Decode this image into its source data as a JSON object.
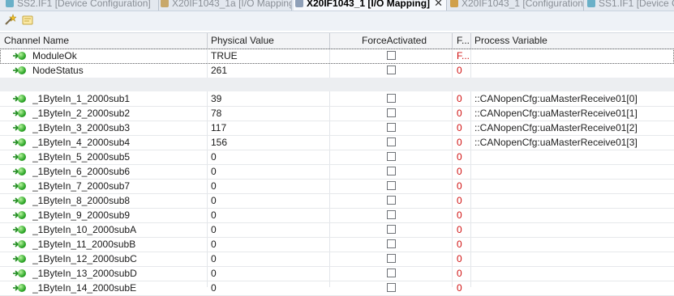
{
  "tabs": [
    {
      "label": "SS2.IF1 [Device Configuration]",
      "active": false,
      "icon_color": "#6ab0c8"
    },
    {
      "label": "X20IF1043_1a [I/O Mapping]",
      "active": false,
      "icon_color": "#c8a86a"
    },
    {
      "label": "X20IF1043_1 [I/O Mapping]",
      "active": true,
      "icon_color": "#8fa0b8"
    },
    {
      "label": "X20IF1043_1 [Configuration]",
      "active": false,
      "icon_color": "#d0a04a"
    },
    {
      "label": "SS1.IF1 [Device C",
      "active": false,
      "icon_color": "#6ab0c8"
    }
  ],
  "close_glyph": "✕",
  "toolbar": {
    "icons": [
      "wand-icon",
      "note-icon"
    ]
  },
  "columns": {
    "channel_name": "Channel Name",
    "physical_value": "Physical Value",
    "force_activated": "ForceActivated",
    "force_value": "F...",
    "process_variable": "Process Variable"
  },
  "rows": [
    {
      "name": "ModuleOk",
      "value": "TRUE",
      "force_activated": false,
      "force_value": "F...",
      "process_variable": "",
      "selected": true
    },
    {
      "name": "NodeStatus",
      "value": "261",
      "force_activated": false,
      "force_value": "0",
      "process_variable": ""
    },
    {
      "gap": true
    },
    {
      "name": "_1ByteIn_1_2000sub1",
      "value": "39",
      "force_activated": false,
      "force_value": "0",
      "process_variable": "::CANopenCfg:uaMasterReceive01[0]"
    },
    {
      "name": "_1ByteIn_2_2000sub2",
      "value": "78",
      "force_activated": false,
      "force_value": "0",
      "process_variable": "::CANopenCfg:uaMasterReceive01[1]"
    },
    {
      "name": "_1ByteIn_3_2000sub3",
      "value": "117",
      "force_activated": false,
      "force_value": "0",
      "process_variable": "::CANopenCfg:uaMasterReceive01[2]"
    },
    {
      "name": "_1ByteIn_4_2000sub4",
      "value": "156",
      "force_activated": false,
      "force_value": "0",
      "process_variable": "::CANopenCfg:uaMasterReceive01[3]"
    },
    {
      "name": "_1ByteIn_5_2000sub5",
      "value": "0",
      "force_activated": false,
      "force_value": "0",
      "process_variable": ""
    },
    {
      "name": "_1ByteIn_6_2000sub6",
      "value": "0",
      "force_activated": false,
      "force_value": "0",
      "process_variable": ""
    },
    {
      "name": "_1ByteIn_7_2000sub7",
      "value": "0",
      "force_activated": false,
      "force_value": "0",
      "process_variable": ""
    },
    {
      "name": "_1ByteIn_8_2000sub8",
      "value": "0",
      "force_activated": false,
      "force_value": "0",
      "process_variable": ""
    },
    {
      "name": "_1ByteIn_9_2000sub9",
      "value": "0",
      "force_activated": false,
      "force_value": "0",
      "process_variable": ""
    },
    {
      "name": "_1ByteIn_10_2000subA",
      "value": "0",
      "force_activated": false,
      "force_value": "0",
      "process_variable": ""
    },
    {
      "name": "_1ByteIn_11_2000subB",
      "value": "0",
      "force_activated": false,
      "force_value": "0",
      "process_variable": ""
    },
    {
      "name": "_1ByteIn_12_2000subC",
      "value": "0",
      "force_activated": false,
      "force_value": "0",
      "process_variable": ""
    },
    {
      "name": "_1ByteIn_13_2000subD",
      "value": "0",
      "force_activated": false,
      "force_value": "0",
      "process_variable": ""
    },
    {
      "name": "_1ByteIn_14_2000subE",
      "value": "0",
      "force_activated": false,
      "force_value": "0",
      "process_variable": ""
    }
  ],
  "colors": {
    "force_value_red": "#d01010",
    "led_green": "#2fa82a",
    "active_tab_bg": "#f7f9fc"
  }
}
